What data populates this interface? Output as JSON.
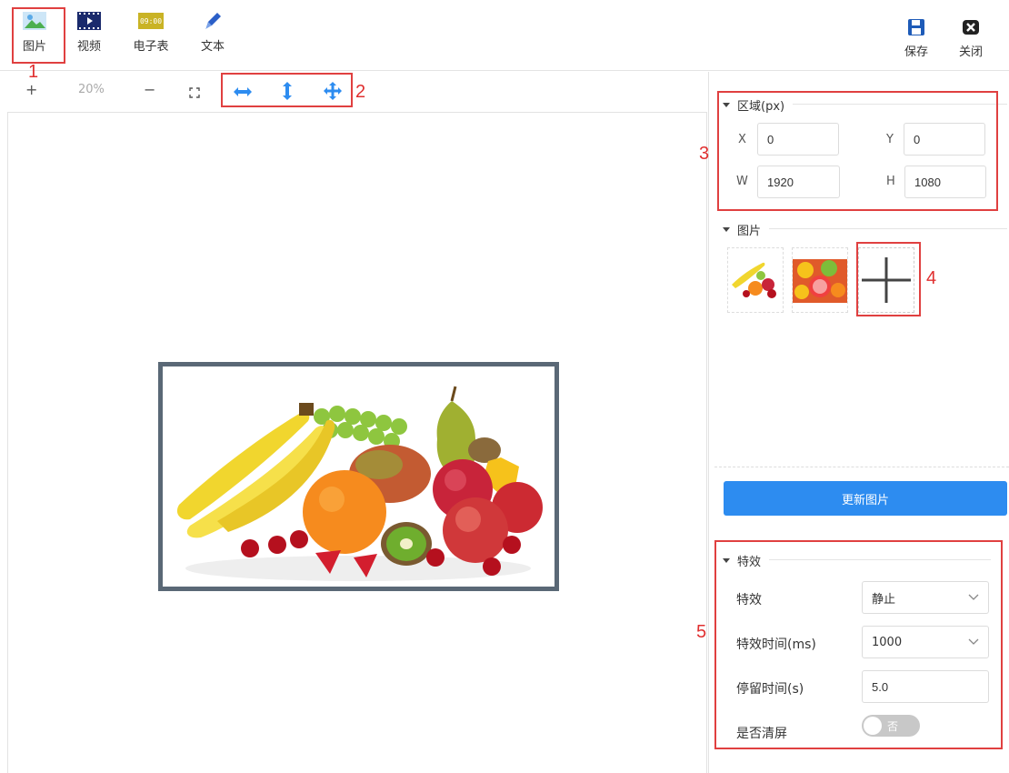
{
  "toolbar": {
    "items": [
      {
        "label": "图片",
        "icon": "image-icon"
      },
      {
        "label": "视频",
        "icon": "video-icon"
      },
      {
        "label": "电子表",
        "icon": "clock-icon",
        "clock_text": "09:00"
      },
      {
        "label": "文本",
        "icon": "pencil-icon"
      }
    ],
    "save_label": "保存",
    "close_label": "关闭"
  },
  "zoom": {
    "plus": "+",
    "value": "20%",
    "minus": "−"
  },
  "annotations": [
    "1",
    "2",
    "3",
    "4",
    "5"
  ],
  "region": {
    "title": "区域(px)",
    "x_label": "X",
    "x_value": "0",
    "y_label": "Y",
    "y_value": "0",
    "w_label": "W",
    "w_value": "1920",
    "h_label": "H",
    "h_value": "1080"
  },
  "images": {
    "title": "图片",
    "thumbnails": [
      "fruit-pile-thumbnail",
      "citrus-fruits-thumbnail"
    ],
    "add_icon": "plus-icon",
    "update_button": "更新图片"
  },
  "effects": {
    "title": "特效",
    "effect_label": "特效",
    "effect_value": "静止",
    "duration_label": "特效时间(ms)",
    "duration_value": "1000",
    "stay_label": "停留时间(s)",
    "stay_value": "5.0",
    "clear_label": "是否清屏",
    "clear_toggle_text": "否"
  },
  "colors": {
    "accent": "#2d8cf0",
    "annotation": "#e03030",
    "frame": "#5a6876"
  }
}
